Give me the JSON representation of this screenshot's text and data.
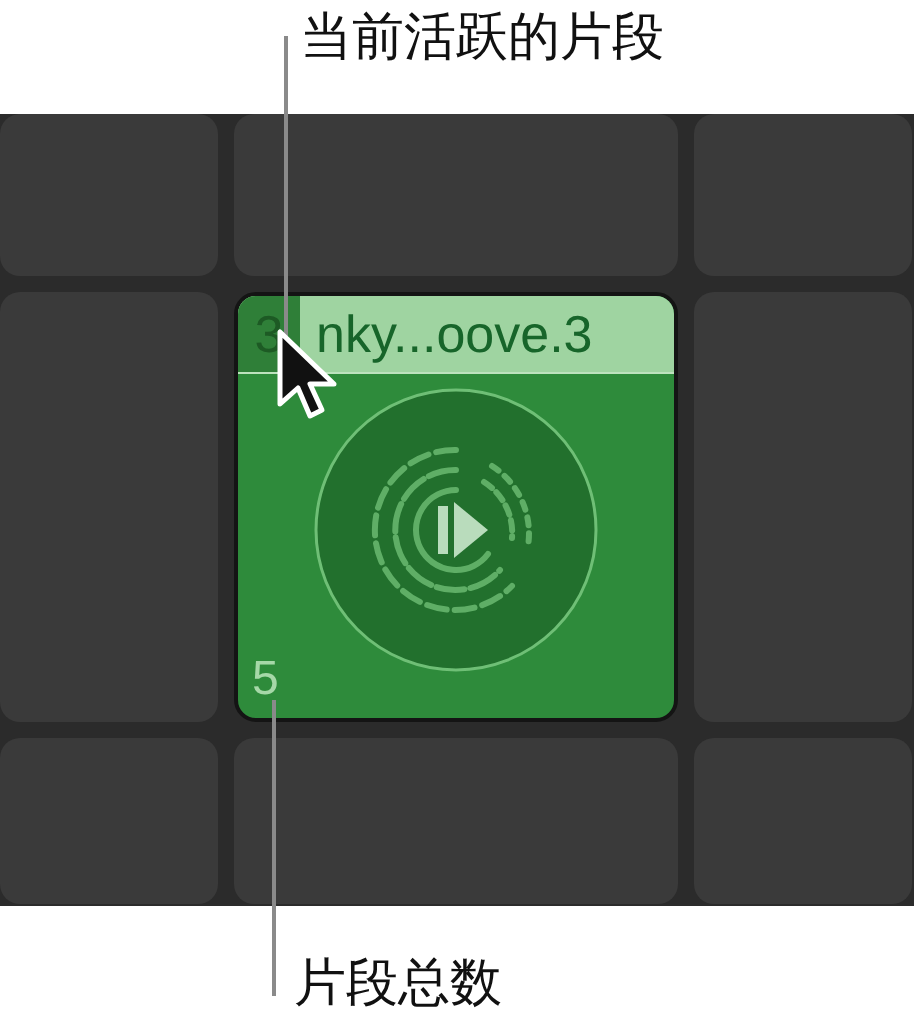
{
  "callouts": [
    {
      "kind": "top",
      "text": "当前活跃的片段"
    },
    {
      "kind": "bottom",
      "text": "片段总数"
    }
  ],
  "grid": {
    "cells": [
      {
        "kind": "empty"
      },
      {
        "kind": "empty"
      },
      {
        "kind": "empty"
      },
      {
        "kind": "empty"
      },
      {
        "kind": "clip",
        "badge": "3",
        "title": "nky...oove.3",
        "count": "5"
      },
      {
        "kind": "empty"
      },
      {
        "kind": "empty"
      },
      {
        "kind": "empty"
      },
      {
        "kind": "empty"
      }
    ]
  }
}
